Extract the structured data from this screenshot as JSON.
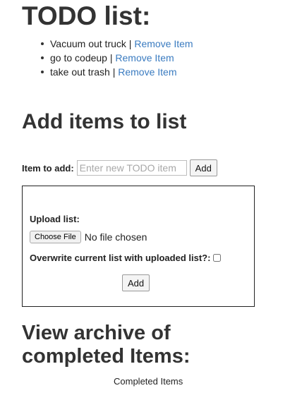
{
  "page": {
    "title": "TODO list:",
    "add_heading": "Add items to list",
    "archive_heading_line1": "View archive of",
    "archive_heading_line2": "completed Items:",
    "completed_label": "Completed Items"
  },
  "todo_items": [
    {
      "text": "Vacuum out truck",
      "separator": " | ",
      "remove_label": "Remove Item"
    },
    {
      "text": "go to codeup",
      "separator": " | ",
      "remove_label": "Remove Item"
    },
    {
      "text": "take out trash",
      "separator": " | ",
      "remove_label": "Remove Item"
    }
  ],
  "add_form": {
    "label": "Item to add:",
    "input_value": "",
    "input_placeholder": "Enter new TODO item",
    "button_label": "Add"
  },
  "upload_form": {
    "label": "Upload list:",
    "choose_file_label": "Choose File",
    "file_status": "No file chosen",
    "overwrite_label": "Overwrite current list with uploaded list?:",
    "overwrite_checked": false,
    "button_label": "Add"
  },
  "colors": {
    "link": "#3a7bc0",
    "heading": "#333333",
    "border": "#222222"
  }
}
